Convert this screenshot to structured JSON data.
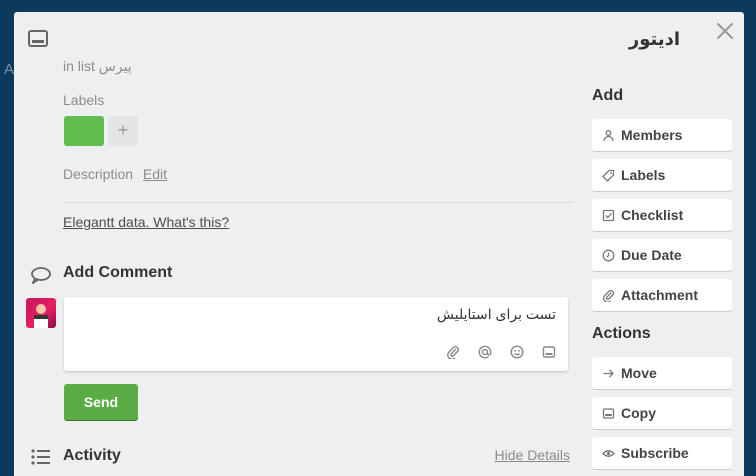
{
  "backdrop": {
    "partial_text": "A"
  },
  "card": {
    "title": "ادیتور",
    "in_list_prefix": "in list",
    "list_name": "پیرس",
    "labels_heading": "Labels",
    "label_add": "+",
    "description_label": "Description",
    "description_edit": "Edit",
    "elegantt_link": "Elegantt data. What's this?",
    "comment_heading": "Add Comment",
    "comment_text": "تست برای استایلیش",
    "send_label": "Send",
    "activity_heading": "Activity",
    "hide_details": "Hide Details",
    "colors": {
      "label": "#61bd4f",
      "send": "#5aac44"
    }
  },
  "sidebar": {
    "add_heading": "Add",
    "add_buttons": [
      {
        "label": "Members",
        "icon": "person-icon"
      },
      {
        "label": "Labels",
        "icon": "tag-icon"
      },
      {
        "label": "Checklist",
        "icon": "checkbox-icon"
      },
      {
        "label": "Due Date",
        "icon": "clock-icon"
      },
      {
        "label": "Attachment",
        "icon": "paperclip-icon"
      }
    ],
    "actions_heading": "Actions",
    "action_buttons": [
      {
        "label": "Move",
        "icon": "arrow-right-icon"
      },
      {
        "label": "Copy",
        "icon": "card-icon"
      },
      {
        "label": "Subscribe",
        "icon": "eye-icon"
      }
    ]
  }
}
